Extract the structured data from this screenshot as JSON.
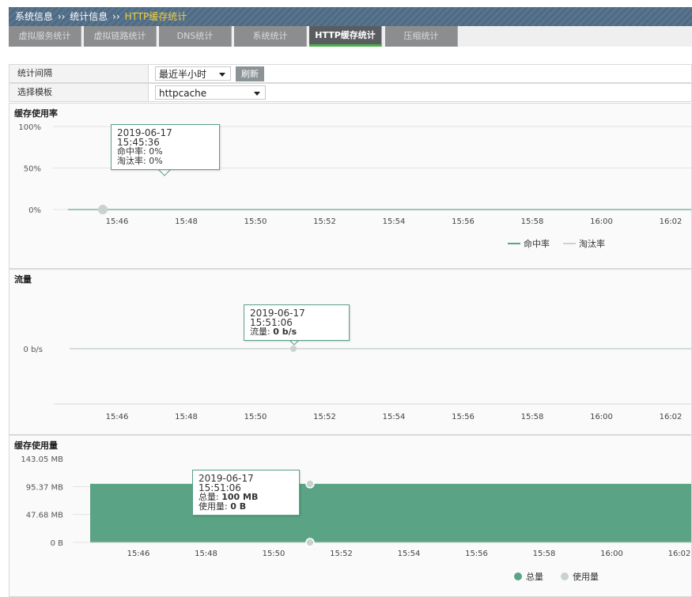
{
  "breadcrumb": {
    "root": "系统信息",
    "sep": "››",
    "middle": "统计信息",
    "current": "HTTP缓存统计"
  },
  "tabs": [
    {
      "label": "虚拟服务统计",
      "active": false
    },
    {
      "label": "虚拟链路统计",
      "active": false
    },
    {
      "label": "DNS统计",
      "active": false
    },
    {
      "label": "系统统计",
      "active": false
    },
    {
      "label": "HTTP缓存统计",
      "active": true
    },
    {
      "label": "压缩统计",
      "active": false
    }
  ],
  "form": {
    "interval": {
      "label": "统计间隔",
      "value": "最近半小时",
      "refresh": "刷新"
    },
    "template": {
      "label": "选择模板",
      "value": "httpcache"
    }
  },
  "colors": {
    "primary": "#5aa384",
    "secondary": "#c8d3cf",
    "accent": "#f4d03f"
  },
  "panels": {
    "hit_rate": {
      "title": "缓存使用率",
      "tooltip": {
        "time": "2019-06-17 15:45:36",
        "line1": "命中率: 0%",
        "line2": "淘汰率: 0%"
      }
    },
    "traffic": {
      "title": "流量",
      "tooltip": {
        "time": "2019-06-17 15:51:06",
        "label": "流量:",
        "value": "0 b/s"
      }
    },
    "cache_usage": {
      "title": "缓存使用量",
      "tooltip": {
        "time": "2019-06-17 15:51:06",
        "total_label": "总量:",
        "total_value": "100 MB",
        "used_label": "使用量:",
        "used_value": "0 B"
      }
    }
  },
  "chart_data": [
    {
      "type": "line",
      "title": "缓存使用率",
      "x_ticks": [
        "15:46",
        "15:48",
        "15:50",
        "15:52",
        "15:54",
        "15:56",
        "15:58",
        "16:00",
        "16:02"
      ],
      "y_ticks": [
        "100%",
        "50%",
        "0%"
      ],
      "ylim": [
        0,
        100
      ],
      "series": [
        {
          "name": "命中率",
          "color": "#5aa384",
          "values": [
            0,
            0,
            0,
            0,
            0,
            0,
            0,
            0,
            0
          ]
        },
        {
          "name": "淘汰率",
          "color": "#c8d3cf",
          "values": [
            0,
            0,
            0,
            0,
            0,
            0,
            0,
            0,
            0
          ]
        }
      ],
      "legend": "bottom-right"
    },
    {
      "type": "line",
      "title": "流量",
      "x_ticks": [
        "15:46",
        "15:48",
        "15:50",
        "15:52",
        "15:54",
        "15:56",
        "15:58",
        "16:00",
        "16:02"
      ],
      "y_ticks": [
        "0 b/s"
      ],
      "series": [
        {
          "values": [
            0,
            0,
            0,
            0,
            0,
            0,
            0,
            0,
            0
          ]
        }
      ]
    },
    {
      "type": "area",
      "title": "缓存使用量",
      "x_ticks": [
        "15:46",
        "15:48",
        "15:50",
        "15:52",
        "15:54",
        "15:56",
        "15:58",
        "16:00",
        "16:02"
      ],
      "y_ticks": [
        "143.05 MB",
        "95.37 MB",
        "47.68 MB",
        "0 B"
      ],
      "ylim": [
        0,
        143.05
      ],
      "series": [
        {
          "name": "总量",
          "color": "#5aa384",
          "values": [
            100,
            100,
            100,
            100,
            100,
            100,
            100,
            100,
            100
          ]
        },
        {
          "name": "使用量",
          "color": "#c8d3cf",
          "values": [
            0,
            0,
            0,
            0,
            0,
            0,
            0,
            0,
            0
          ]
        }
      ],
      "legend": "bottom-right"
    }
  ]
}
